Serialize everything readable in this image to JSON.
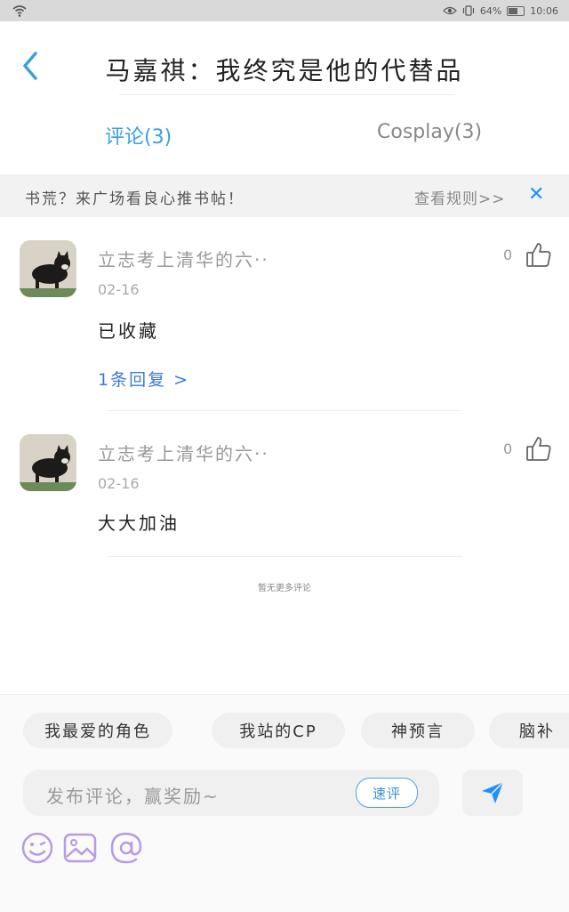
{
  "status_bar": {
    "battery": "64%",
    "time": "10:06"
  },
  "header": {
    "title": "马嘉祺：我终究是他的代替品"
  },
  "tabs": [
    {
      "label": "评论(3)"
    },
    {
      "label": "Cosplay(3)"
    }
  ],
  "notice": {
    "text": "书荒？来广场看良心推书帖！",
    "rules_link": "查看规则>>",
    "close_symbol": "✕"
  },
  "comments": [
    {
      "username": "立志考上清华的六··",
      "date": "02-16",
      "text": "已收藏",
      "likes": "0",
      "replies": "1条回复 >"
    },
    {
      "username": "立志考上清华的六··",
      "date": "02-16",
      "text": "大大加油",
      "likes": "0"
    }
  ],
  "footer_note": "暂无更多评论",
  "quick_tags": [
    "我最爱的角色",
    "我站的CP",
    "神预言",
    "脑补"
  ],
  "comment_input": {
    "placeholder": "发布评论，赢奖励~",
    "quick_button": "速评"
  },
  "icons": {
    "back": "chevron-left-icon",
    "like": "thumbs-up-icon",
    "send": "paper-plane-icon",
    "tools": [
      "emoji-icon",
      "image-icon",
      "at-icon"
    ]
  },
  "colors": {
    "accent": "#3aa0e0",
    "close": "#1e90ff",
    "tool_purple": "#b79be6"
  }
}
